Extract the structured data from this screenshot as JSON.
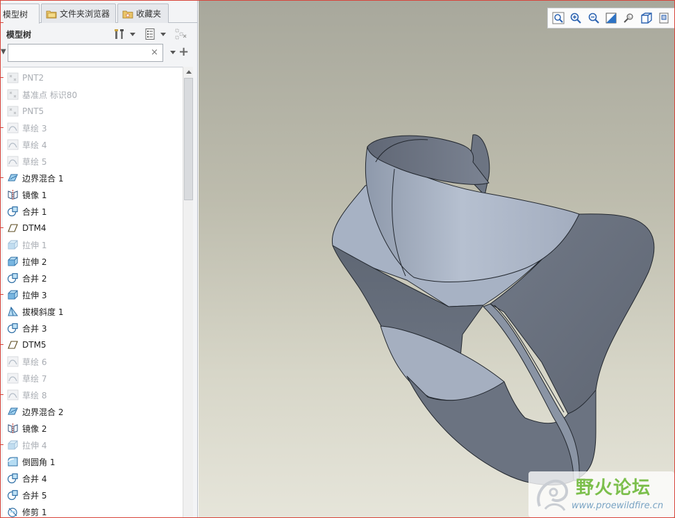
{
  "tabs": [
    {
      "label": "模型树",
      "icon": "model-tree-icon",
      "active": true
    },
    {
      "label": "文件夹浏览器",
      "icon": "folder-browser-icon",
      "active": false
    },
    {
      "label": "收藏夹",
      "icon": "favorites-icon",
      "active": false
    }
  ],
  "tree_header": {
    "title": "模型树"
  },
  "search": {
    "value": "",
    "placeholder": "",
    "clear_symbol": "×",
    "add_symbol": "+"
  },
  "tree_items": [
    {
      "label": "PNT2",
      "icon": "datum-point-icon",
      "suppressed": true
    },
    {
      "label": "基准点 标识80",
      "icon": "datum-point-icon",
      "suppressed": true
    },
    {
      "label": "PNT5",
      "icon": "datum-point-icon",
      "suppressed": true
    },
    {
      "label": "草绘 3",
      "icon": "sketch-icon",
      "suppressed": true
    },
    {
      "label": "草绘 4",
      "icon": "sketch-icon",
      "suppressed": true
    },
    {
      "label": "草绘 5",
      "icon": "sketch-icon",
      "suppressed": true
    },
    {
      "label": "边界混合 1",
      "icon": "boundary-blend-icon",
      "suppressed": false
    },
    {
      "label": "镜像 1",
      "icon": "mirror-icon",
      "suppressed": false
    },
    {
      "label": "合并 1",
      "icon": "merge-icon",
      "suppressed": false
    },
    {
      "label": "DTM4",
      "icon": "datum-plane-icon",
      "suppressed": false
    },
    {
      "label": "拉伸 1",
      "icon": "extrude-icon",
      "suppressed": true
    },
    {
      "label": "拉伸 2",
      "icon": "extrude-icon",
      "suppressed": false
    },
    {
      "label": "合并 2",
      "icon": "merge-icon",
      "suppressed": false
    },
    {
      "label": "拉伸 3",
      "icon": "extrude-icon",
      "suppressed": false
    },
    {
      "label": "拔模斜度 1",
      "icon": "draft-icon",
      "suppressed": false
    },
    {
      "label": "合并 3",
      "icon": "merge-icon",
      "suppressed": false
    },
    {
      "label": "DTM5",
      "icon": "datum-plane-icon",
      "suppressed": false
    },
    {
      "label": "草绘 6",
      "icon": "sketch-icon",
      "suppressed": true
    },
    {
      "label": "草绘 7",
      "icon": "sketch-icon",
      "suppressed": true
    },
    {
      "label": "草绘 8",
      "icon": "sketch-icon",
      "suppressed": true
    },
    {
      "label": "边界混合 2",
      "icon": "boundary-blend-icon",
      "suppressed": false
    },
    {
      "label": "镜像 2",
      "icon": "mirror-icon",
      "suppressed": false
    },
    {
      "label": "拉伸 4",
      "icon": "extrude-icon",
      "suppressed": true
    },
    {
      "label": "倒圆角 1",
      "icon": "round-icon",
      "suppressed": false
    },
    {
      "label": "合并 4",
      "icon": "merge-icon",
      "suppressed": false
    },
    {
      "label": "合并 5",
      "icon": "merge-icon",
      "suppressed": false
    },
    {
      "label": "修剪 1",
      "icon": "trim-icon",
      "suppressed": false
    }
  ],
  "view_toolbar": [
    {
      "name": "refit-button",
      "icon": "refit-icon"
    },
    {
      "name": "zoom-in-button",
      "icon": "zoom-in-icon"
    },
    {
      "name": "zoom-out-button",
      "icon": "zoom-out-icon"
    },
    {
      "name": "repaint-button",
      "icon": "repaint-icon"
    },
    {
      "name": "perspective-button",
      "icon": "perspective-icon"
    },
    {
      "name": "display-style-button",
      "icon": "shaded-cube-icon"
    },
    {
      "name": "saved-views-button",
      "icon": "saved-views-icon"
    }
  ],
  "watermark": {
    "title": "野火论坛",
    "url": "www.proewildfire.cn",
    "icon": "wildfire-logo-icon"
  },
  "colors": {
    "face_light": "#a9b4c6",
    "face_mid": "#8d97a8",
    "face_dark": "#6c7482",
    "edge": "#22272e",
    "bg_top": "#a8a89c",
    "bg_bottom": "#e6e5da"
  }
}
